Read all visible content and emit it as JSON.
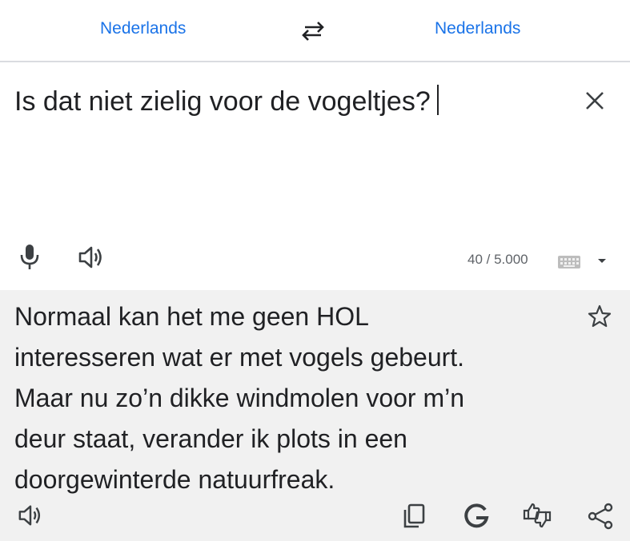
{
  "header": {
    "source_language": "Nederlands",
    "target_language": "Nederlands",
    "swap_icon": "swap-arrows-icon"
  },
  "input": {
    "text": "Is dat niet zielig voor de vogeltjes?",
    "char_count": "40 / 5.000",
    "icons": [
      "mic-icon",
      "volume-icon",
      "close-icon",
      "keyboard-icon",
      "dropdown-arrow-icon"
    ]
  },
  "output": {
    "lines": [
      "Normaal kan het me geen HOL",
      "interesseren wat er met vogels gebeurt.",
      "Maar nu zo’n dikke windmolen voor m’n",
      "deur staat, verander ik plots in een",
      "doorgewinterde natuurfreak."
    ],
    "icons": [
      "star-icon",
      "volume-icon",
      "copy-icon",
      "google-g-icon",
      "feedback-icon",
      "share-icon"
    ]
  },
  "colors": {
    "accent": "#1a73e8",
    "text": "#202124",
    "muted": "#5f6368",
    "output_bg": "#f1f1f1",
    "divider": "#dadce0"
  }
}
